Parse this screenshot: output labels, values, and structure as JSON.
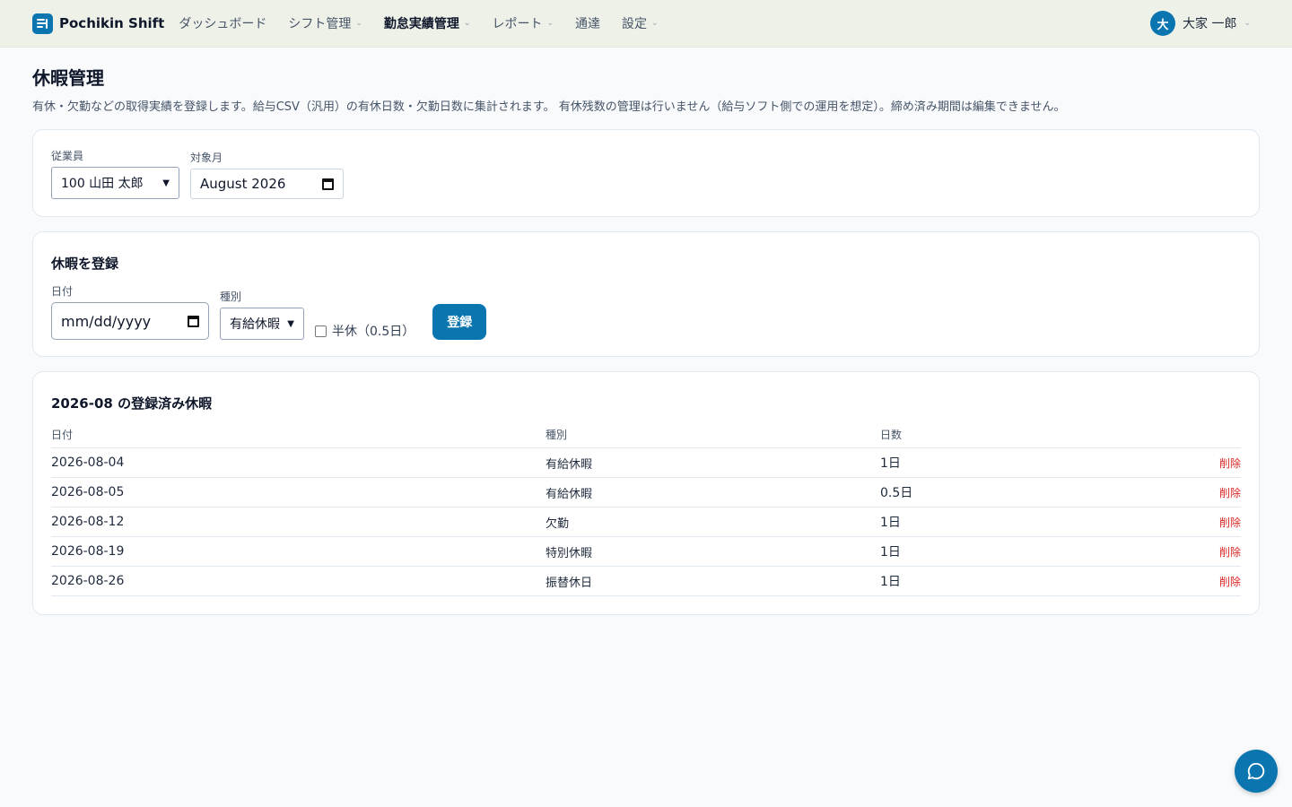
{
  "header": {
    "brand": "Pochikin Shift",
    "nav": [
      {
        "label": "ダッシュボード",
        "dropdown": false,
        "active": false
      },
      {
        "label": "シフト管理",
        "dropdown": true,
        "active": false
      },
      {
        "label": "勤怠実績管理",
        "dropdown": true,
        "active": true
      },
      {
        "label": "レポート",
        "dropdown": true,
        "active": false
      },
      {
        "label": "通達",
        "dropdown": false,
        "active": false
      },
      {
        "label": "設定",
        "dropdown": true,
        "active": false
      }
    ],
    "user": {
      "avatar": "大",
      "name": "大家 一郎"
    }
  },
  "page": {
    "title": "休暇管理",
    "description": "有休・欠勤などの取得実績を登録します。給与CSV（汎用）の有休日数・欠勤日数に集計されます。 有休残数の管理は行いません（給与ソフト側での運用を想定）。締め済み期間は編集できません。"
  },
  "filters": {
    "employee_label": "従業員",
    "employee_value": "100 山田 太郎",
    "month_label": "対象月",
    "month_value": "August  2026"
  },
  "register": {
    "title": "休暇を登録",
    "date_label": "日付",
    "date_placeholder": "mm/dd/yyyy",
    "type_label": "種別",
    "type_value": "有給休暇",
    "half_day_label": "半休（0.5日）",
    "half_day_checked": false,
    "submit_label": "登録"
  },
  "list": {
    "title": "2026-08 の登録済み休暇",
    "columns": {
      "date": "日付",
      "type": "種別",
      "days": "日数"
    },
    "rows": [
      {
        "date": "2026-08-04",
        "type": "有給休暇",
        "days": "1日",
        "action": "削除"
      },
      {
        "date": "2026-08-05",
        "type": "有給休暇",
        "days": "0.5日",
        "action": "削除"
      },
      {
        "date": "2026-08-12",
        "type": "欠勤",
        "days": "1日",
        "action": "削除"
      },
      {
        "date": "2026-08-19",
        "type": "特別休暇",
        "days": "1日",
        "action": "削除"
      },
      {
        "date": "2026-08-26",
        "type": "振替休日",
        "days": "1日",
        "action": "削除"
      }
    ]
  },
  "colors": {
    "accent": "#0b75b0",
    "danger": "#dc2626",
    "header_bg": "#eef1e8"
  },
  "icons": {
    "brand": "shift-logo-icon",
    "chevron": "chevron-down-icon",
    "calendar": "calendar-icon",
    "chat": "chat-bubble-icon"
  }
}
